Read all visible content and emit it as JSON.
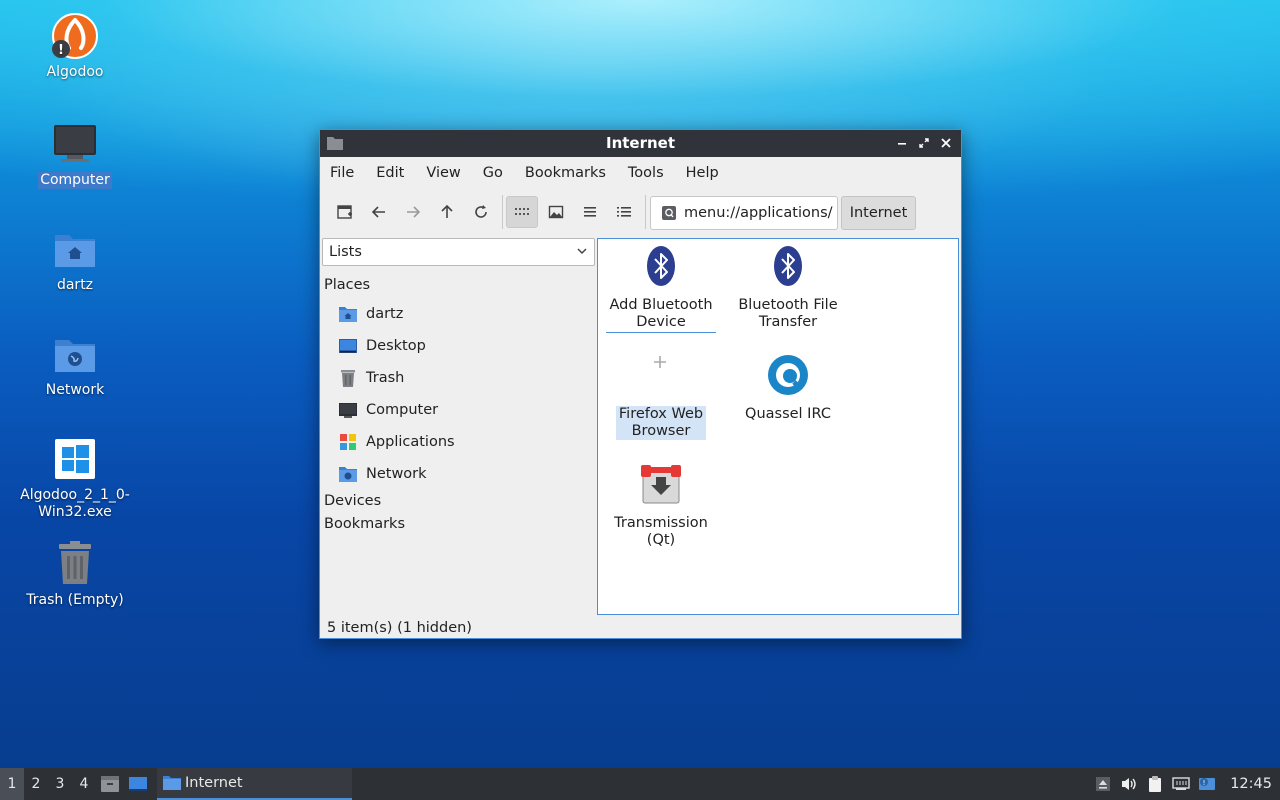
{
  "desktop": {
    "icons": [
      {
        "label": "Algodoo"
      },
      {
        "label": "Computer"
      },
      {
        "label": "dartz"
      },
      {
        "label": "Network"
      },
      {
        "label": "Algodoo_2_1_0-Win32.exe"
      },
      {
        "label": "Trash (Empty)"
      }
    ]
  },
  "window": {
    "title": "Internet",
    "menu": [
      "File",
      "Edit",
      "View",
      "Go",
      "Bookmarks",
      "Tools",
      "Help"
    ],
    "path": "menu://applications/",
    "breadcrumb": "Internet",
    "side": {
      "selector": "Lists",
      "places_heading": "Places",
      "places": [
        "dartz",
        "Desktop",
        "Trash",
        "Computer",
        "Applications",
        "Network"
      ],
      "devices_heading": "Devices",
      "bookmarks_heading": "Bookmarks"
    },
    "apps": [
      {
        "label": "Add Bluetooth Device",
        "line1": "Add Bluetooth",
        "line2": "Device"
      },
      {
        "label": "Bluetooth File Transfer",
        "line1": "Bluetooth File",
        "line2": "Transfer"
      },
      {
        "label": "Firefox Web Browser",
        "line1": "Firefox Web",
        "line2": "Browser"
      },
      {
        "label": "Quassel IRC",
        "line1": "Quassel IRC",
        "line2": ""
      },
      {
        "label": "Transmission (Qt)",
        "line1": "Transmission",
        "line2": "(Qt)"
      }
    ],
    "status": "5 item(s) (1 hidden)"
  },
  "taskbar": {
    "workspaces": [
      "1",
      "2",
      "3",
      "4"
    ],
    "active_workspace": "1",
    "task_label": "Internet",
    "clock": "12:45"
  },
  "colors": {
    "accent": "#4a8fd8",
    "titlebar": "#30343a",
    "taskbar": "#2d3035"
  }
}
